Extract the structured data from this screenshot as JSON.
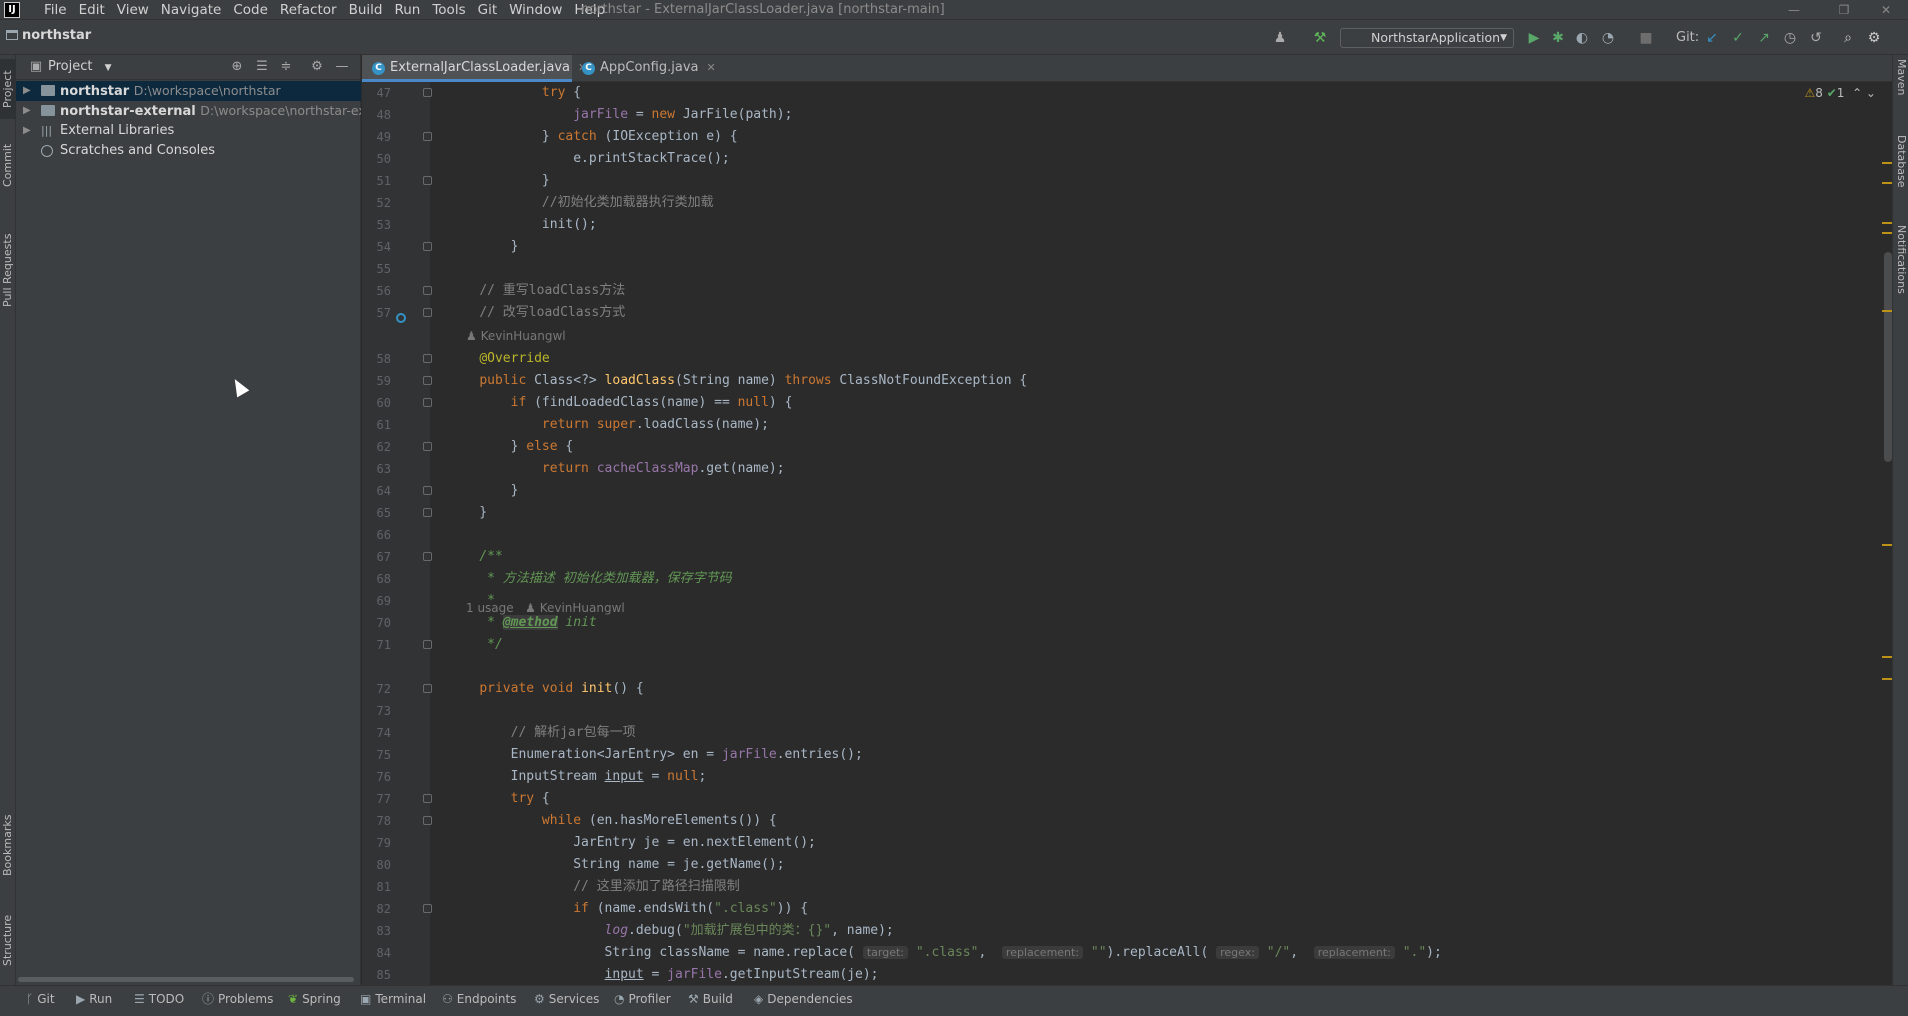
{
  "window": {
    "title": "northstar - ExternalJarClassLoader.java [northstar-main]",
    "menu": [
      "File",
      "Edit",
      "View",
      "Navigate",
      "Code",
      "Refactor",
      "Build",
      "Run",
      "Tools",
      "Git",
      "Window",
      "Help"
    ],
    "controls": [
      "—",
      "❐",
      "✕"
    ]
  },
  "navbar": {
    "project": "northstar",
    "run_config": "NorthstarApplication",
    "git_label": "Git:"
  },
  "left_stripe": [
    "Project",
    "Commit",
    "Pull Requests",
    "Bookmarks",
    "Structure"
  ],
  "right_stripe": [
    "Maven",
    "Database",
    "Notifications"
  ],
  "project_panel": {
    "title": "Project",
    "tree": [
      {
        "label": "northstar",
        "path": "D:\\workspace\\northstar",
        "expanded": false,
        "bold": true
      },
      {
        "label": "northstar-external",
        "path": "D:\\workspace\\northstar-external",
        "expanded": false,
        "bold": true
      },
      {
        "label": "External Libraries",
        "path": "",
        "expanded": false,
        "bold": false
      },
      {
        "label": "Scratches and Consoles",
        "path": "",
        "expanded": false,
        "bold": false
      }
    ]
  },
  "tabs": [
    {
      "label": "ExternalJarClassLoader.java",
      "active": true
    },
    {
      "label": "AppConfig.java",
      "active": false
    }
  ],
  "editor": {
    "warnings": "8",
    "checks": "1",
    "author_hint_1": "KevinHuangwl",
    "usage_hint": "1 usage",
    "author_hint_2": "KevinHuangwl",
    "line_numbers": [
      "47",
      "48",
      "49",
      "50",
      "51",
      "52",
      "53",
      "54",
      "55",
      "56",
      "57",
      "58",
      "59",
      "60",
      "61",
      "62",
      "63",
      "64",
      "65",
      "66",
      "67",
      "68",
      "69",
      "70",
      "71",
      "72",
      "73",
      "74",
      "75",
      "76",
      "77",
      "78",
      "79",
      "80",
      "81",
      "82",
      "83",
      "84",
      "85"
    ]
  },
  "bottom_tools": [
    "Git",
    "Run",
    "TODO",
    "Problems",
    "Spring",
    "Terminal",
    "Endpoints",
    "Services",
    "Profiler",
    "Build",
    "Dependencies"
  ],
  "colors": {
    "accent": "#4a88c7",
    "keyword": "#cc7832",
    "string": "#6a8759",
    "comment": "#808080",
    "doc": "#629755"
  }
}
